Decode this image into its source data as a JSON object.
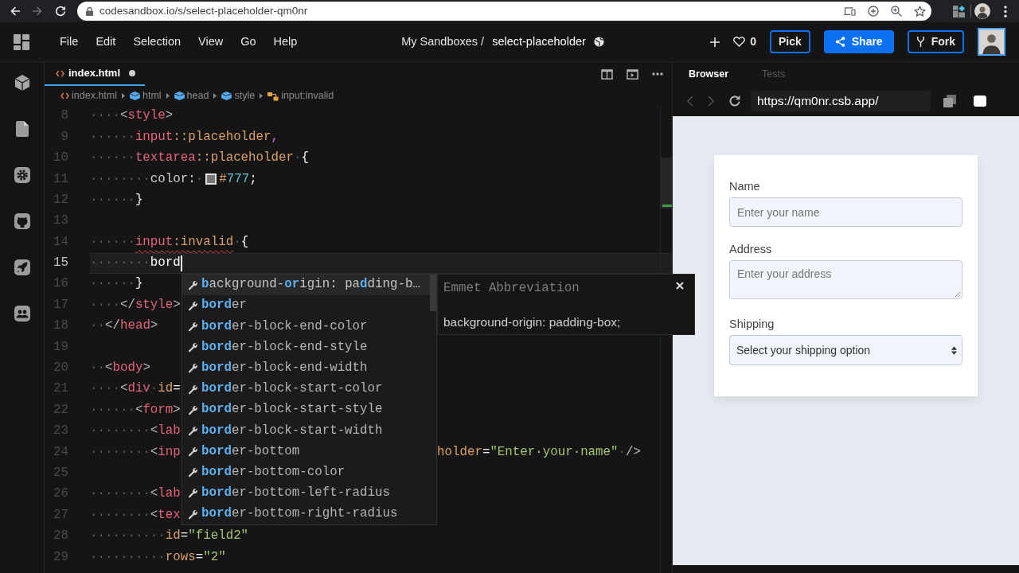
{
  "browser": {
    "nav": [
      {
        "disabled": false
      },
      {
        "disabled": true
      }
    ],
    "url": "codesandbox.io/s/select-placeholder-qm0nr"
  },
  "menu": [
    "File",
    "Edit",
    "Selection",
    "View",
    "Go",
    "Help"
  ],
  "sandbox": {
    "folder": "My Sandboxes /",
    "name": "select-placeholder"
  },
  "actions": {
    "likes": "0",
    "buttons": [
      {
        "label": "Pick",
        "kind": "outline"
      },
      {
        "label": "Share",
        "kind": "primary"
      },
      {
        "label": "Fork",
        "kind": "outline"
      }
    ]
  },
  "editor": {
    "tabs": [
      {
        "label": "index.html",
        "selected": true,
        "modified": true
      }
    ],
    "breadcrumb": [
      {
        "label": "index.html",
        "kind": "file"
      },
      {
        "label": "html",
        "kind": "element"
      },
      {
        "label": "head",
        "kind": "element"
      },
      {
        "label": "style",
        "kind": "element"
      },
      {
        "label": "input:invalid",
        "kind": "rule"
      }
    ],
    "lines": [
      {
        "number": "8",
        "current": false,
        "error": false,
        "tokens": [
          {
            "kind": "ws",
            "text": "····"
          },
          {
            "kind": "punct",
            "text": "<"
          },
          {
            "kind": "tag",
            "text": "style"
          },
          {
            "kind": "punct",
            "text": ">"
          }
        ]
      },
      {
        "number": "9",
        "current": false,
        "error": false,
        "tokens": [
          {
            "kind": "ws",
            "text": "······"
          },
          {
            "kind": "sel",
            "text": "input"
          },
          {
            "kind": "pseudo",
            "text": "::placeholder"
          },
          {
            "kind": "comma",
            "text": ","
          }
        ]
      },
      {
        "number": "10",
        "current": false,
        "error": false,
        "tokens": [
          {
            "kind": "ws",
            "text": "······"
          },
          {
            "kind": "sel",
            "text": "textarea"
          },
          {
            "kind": "pseudo",
            "text": "::placeholder"
          },
          {
            "kind": "ws",
            "text": "·"
          },
          {
            "kind": "brace",
            "text": "{"
          }
        ]
      },
      {
        "number": "11",
        "current": false,
        "error": false,
        "tokens": [
          {
            "kind": "ws",
            "text": "········"
          },
          {
            "kind": "prop",
            "text": "color:"
          },
          {
            "kind": "ws",
            "text": "·"
          },
          {
            "kind": "swatch",
            "color": "#777777"
          },
          {
            "kind": "hash",
            "text": "#"
          },
          {
            "kind": "num",
            "text": "777"
          },
          {
            "kind": "brace",
            "text": ";"
          }
        ]
      },
      {
        "number": "12",
        "current": false,
        "error": false,
        "tokens": [
          {
            "kind": "ws",
            "text": "······"
          },
          {
            "kind": "brace",
            "text": "}"
          }
        ]
      },
      {
        "number": "13",
        "current": false,
        "error": false
      },
      {
        "number": "14",
        "current": false,
        "error": true,
        "tokens": [
          {
            "kind": "ws",
            "text": "······"
          },
          {
            "kind": "sel",
            "text": "input"
          },
          {
            "kind": "pseudo",
            "text": ":invalid"
          },
          {
            "kind": "ws",
            "text": "·"
          },
          {
            "kind": "brace",
            "text": "{"
          }
        ]
      },
      {
        "number": "15",
        "current": true,
        "error": false,
        "tokens": [
          {
            "kind": "ws",
            "text": "········"
          },
          {
            "kind": "typed",
            "text": "bord"
          }
        ]
      },
      {
        "number": "16",
        "current": false,
        "error": false,
        "tokens": [
          {
            "kind": "ws",
            "text": "······"
          },
          {
            "kind": "brace",
            "text": "}"
          }
        ]
      },
      {
        "number": "17",
        "current": false,
        "error": false,
        "tokens": [
          {
            "kind": "ws",
            "text": "····"
          },
          {
            "kind": "punct",
            "text": "</"
          },
          {
            "kind": "tag",
            "text": "style"
          },
          {
            "kind": "punct",
            "text": ">"
          }
        ]
      },
      {
        "number": "18",
        "current": false,
        "error": false,
        "tokens": [
          {
            "kind": "ws",
            "text": "··"
          },
          {
            "kind": "punct",
            "text": "</"
          },
          {
            "kind": "tag",
            "text": "head"
          },
          {
            "kind": "punct",
            "text": ">"
          }
        ]
      },
      {
        "number": "19",
        "current": false,
        "error": false
      },
      {
        "number": "20",
        "current": false,
        "error": false,
        "tokens": [
          {
            "kind": "ws",
            "text": "··"
          },
          {
            "kind": "punct",
            "text": "<"
          },
          {
            "kind": "tag",
            "text": "body"
          },
          {
            "kind": "punct",
            "text": ">"
          }
        ]
      },
      {
        "number": "21",
        "current": false,
        "error": false,
        "tokens": [
          {
            "kind": "ws",
            "text": "····"
          },
          {
            "kind": "punct",
            "text": "<"
          },
          {
            "kind": "tag",
            "text": "div"
          },
          {
            "kind": "ws",
            "text": "·"
          },
          {
            "kind": "attr",
            "text": "id"
          },
          {
            "kind": "eq",
            "text": "="
          }
        ]
      },
      {
        "number": "22",
        "current": false,
        "error": false,
        "tokens": [
          {
            "kind": "ws",
            "text": "······"
          },
          {
            "kind": "punct",
            "text": "<"
          },
          {
            "kind": "tag",
            "text": "form"
          },
          {
            "kind": "punct",
            "text": ">"
          }
        ]
      },
      {
        "number": "23",
        "current": false,
        "error": false,
        "tokens": [
          {
            "kind": "ws",
            "text": "········"
          },
          {
            "kind": "punct",
            "text": "<"
          },
          {
            "kind": "tag",
            "text": "lab"
          }
        ]
      },
      {
        "number": "24",
        "current": false,
        "error": false,
        "tokens": [
          {
            "kind": "ws",
            "text": "········"
          },
          {
            "kind": "punct",
            "text": "<"
          },
          {
            "kind": "tag",
            "text": "inp"
          }
        ],
        "tail_tokens": [
          {
            "kind": "attr",
            "text": "holder"
          },
          {
            "kind": "eq",
            "text": "="
          },
          {
            "kind": "str",
            "text": "\"Enter·your·name\""
          },
          {
            "kind": "ws",
            "text": "·"
          },
          {
            "kind": "punct",
            "text": "/>"
          }
        ]
      },
      {
        "number": "25",
        "current": false,
        "error": false
      },
      {
        "number": "26",
        "current": false,
        "error": false,
        "tokens": [
          {
            "kind": "ws",
            "text": "········"
          },
          {
            "kind": "punct",
            "text": "<"
          },
          {
            "kind": "tag",
            "text": "lab"
          }
        ]
      },
      {
        "number": "27",
        "current": false,
        "error": false,
        "tokens": [
          {
            "kind": "ws",
            "text": "········"
          },
          {
            "kind": "punct",
            "text": "<"
          },
          {
            "kind": "tag",
            "text": "tex"
          }
        ]
      },
      {
        "number": "28",
        "current": false,
        "error": false,
        "tokens": [
          {
            "kind": "ws",
            "text": "··········"
          },
          {
            "kind": "attr",
            "text": "id"
          },
          {
            "kind": "eq",
            "text": "="
          },
          {
            "kind": "str",
            "text": "\"field2\""
          }
        ]
      },
      {
        "number": "29",
        "current": false,
        "error": false,
        "tokens": [
          {
            "kind": "ws",
            "text": "··········"
          },
          {
            "kind": "attr",
            "text": "rows"
          },
          {
            "kind": "eq",
            "text": "="
          },
          {
            "kind": "str",
            "text": "\"2\""
          }
        ]
      }
    ],
    "suggestions": [
      {
        "label": "**b**ackground-**or**igin: pa**d**ding-b…",
        "selected": true
      },
      {
        "label": "**bord**er",
        "selected": false
      },
      {
        "label": "**bord**er-block-end-color",
        "selected": false
      },
      {
        "label": "**bord**er-block-end-style",
        "selected": false
      },
      {
        "label": "**bord**er-block-end-width",
        "selected": false
      },
      {
        "label": "**bord**er-block-start-color",
        "selected": false
      },
      {
        "label": "**bord**er-block-start-style",
        "selected": false
      },
      {
        "label": "**bord**er-block-start-width",
        "selected": false
      },
      {
        "label": "**bord**er-bottom",
        "selected": false
      },
      {
        "label": "**bord**er-bottom-color",
        "selected": false
      },
      {
        "label": "**bord**er-bottom-left-radius",
        "selected": false
      },
      {
        "label": "**bord**er-bottom-right-radius",
        "selected": false
      }
    ],
    "suggestion_detail": {
      "title": "Emmet Abbreviation",
      "text": "background-origin: padding-box;"
    }
  },
  "preview": {
    "tabs": [
      {
        "label": "Browser",
        "selected": true
      },
      {
        "label": "Tests",
        "selected": false
      }
    ],
    "nav": [
      {
        "disabled": true
      },
      {
        "disabled": true
      }
    ],
    "url": "https://qm0nr.csb.app/",
    "fields": [
      {
        "kind": "input",
        "label": "Name",
        "placeholder": "Enter your name"
      },
      {
        "kind": "textarea",
        "label": "Address",
        "placeholder": "Enter your address"
      },
      {
        "kind": "select",
        "label": "Shipping",
        "value": "Select your shipping option"
      }
    ]
  }
}
